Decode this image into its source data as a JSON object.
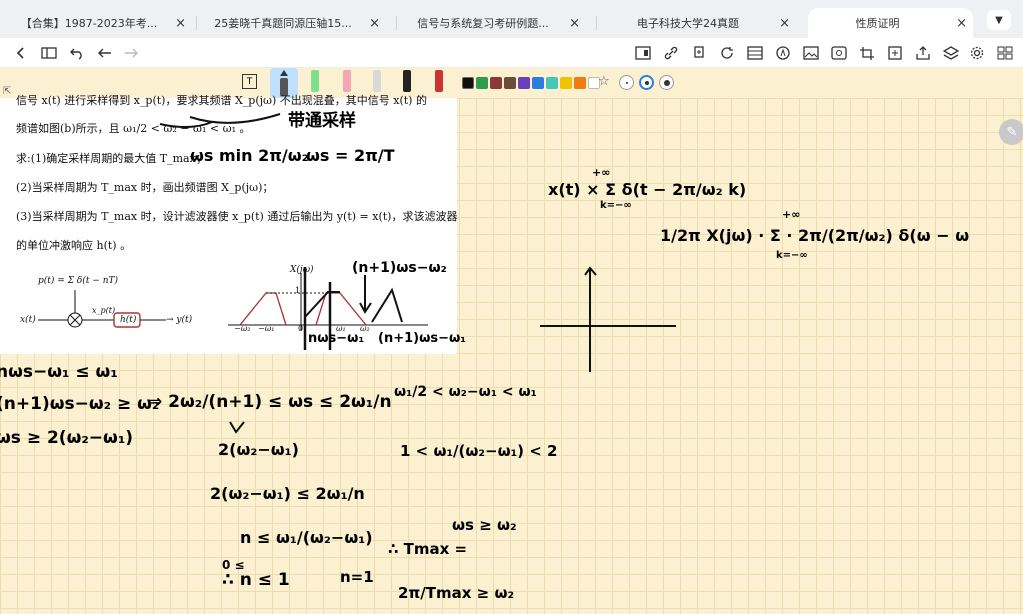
{
  "tabs": [
    {
      "label": "【合集】1987-2023年考...",
      "close": "×"
    },
    {
      "label": "25姜晓千真题同源压轴15...",
      "close": "×"
    },
    {
      "label": "信号与系统复习考研例题...",
      "close": "×"
    },
    {
      "label": "电子科技大学24真题",
      "close": "×"
    },
    {
      "label": "性质证明",
      "close": "×"
    }
  ],
  "tab_dropdown": "▼",
  "toolbar_icons": [
    "back-icon",
    "outline-icon",
    "undo-icon",
    "redo-icon",
    "page-layout-icon",
    "link-icon",
    "copy-icon",
    "refresh-icon",
    "grid-icon",
    "pen-mode-icon",
    "image-icon",
    "stamp-icon",
    "crop-icon",
    "add-page-icon",
    "export-icon",
    "layers-icon",
    "settings-icon",
    "more-icon"
  ],
  "colors": [
    "#111111",
    "#2e9c4a",
    "#8b3a3a",
    "#6b4c3a",
    "#6b3fb5",
    "#2b7de0",
    "#45c7b8",
    "#f0c200",
    "#f07a14",
    "#ffffff"
  ],
  "problem": {
    "line1": "信号 x(t) 进行采样得到 x_p(t)，要求其频谱 X_p(jω) 不出现混叠，其中信号 x(t) 的",
    "line2_a": "频谱如图(b)所示，且",
    "line2_b": "ω₁/2 < ω₂ − ω₁ < ω₁ 。",
    "line3": "求:(1)确定采样周期的最大值 T_max；",
    "line4": "(2)当采样周期为 T_max 时，画出频谱图 X_p(jω)；",
    "line5": "(3)当采样周期为 T_max 时，设计滤波器使 x_p(t) 通过后输出为 y(t) = x(t)，求该滤波器",
    "line6": "的单位冲激响应 h(t) 。",
    "fig_a": {
      "p_label": "p(t) = Σ δ(t − nT)",
      "x_label": "x(t)",
      "xp_label": "x_p(t)",
      "h_label": "h(t)",
      "y_label": "→ y(t)"
    },
    "fig_b": {
      "title": "X(jω)",
      "one": "1",
      "ticks": [
        "−ω₂",
        "−ω₁",
        "0",
        "ω₁",
        "ω₂"
      ]
    }
  },
  "handwriting": {
    "note_bandpass": "带通采样",
    "ws_min": "ωs min  2π/ω₂",
    "ws_def": "ωs = 2π/T",
    "n_top": "(n+1)ωs−ω₂",
    "n_bottom_left": "nωs−ω₁",
    "n_bottom_right": "(n+1)ωs−ω₁",
    "ineq1": "nωs−ω₁ ≤ ω₁",
    "ineq2": "(n+1)ωs−ω₂ ≥ ω₂",
    "ineq3": "ωs ≥ 2(ω₂−ω₁)",
    "range": "⇒ 2ω₂/(n+1) ≤ ωs ≤ 2ω₁/n",
    "step_a": "2(ω₂−ω₁)",
    "step_b": "2(ω₂−ω₁) ≤ 2ω₁/n",
    "step_c": "n ≤ ω₁/(ω₂−ω₁)",
    "step_d": "0 ≤",
    "step_e": "∴ n ≤ 1",
    "n_eq": "n=1",
    "cond": "ω₁/2 < ω₂−ω₁ < ω₁",
    "cond2": "1 < ω₁/(ω₂−ω₁) < 2",
    "ws_ge": "ωs ≥ ω₂",
    "tmax": "∴ Tmax =",
    "final": "2π/Tmax ≥ ω₂",
    "xt_sum": "x(t) × Σ δ(t − 2π/ω₂ k)",
    "xt_sum_top": "+∞",
    "xt_sum_bot": "k=−∞",
    "conv": "1/2π  X(jω) · Σ · 2π/(2π/ω₂) δ(ω − ω",
    "conv_top": "+∞",
    "conv_bot": "k=−∞"
  }
}
